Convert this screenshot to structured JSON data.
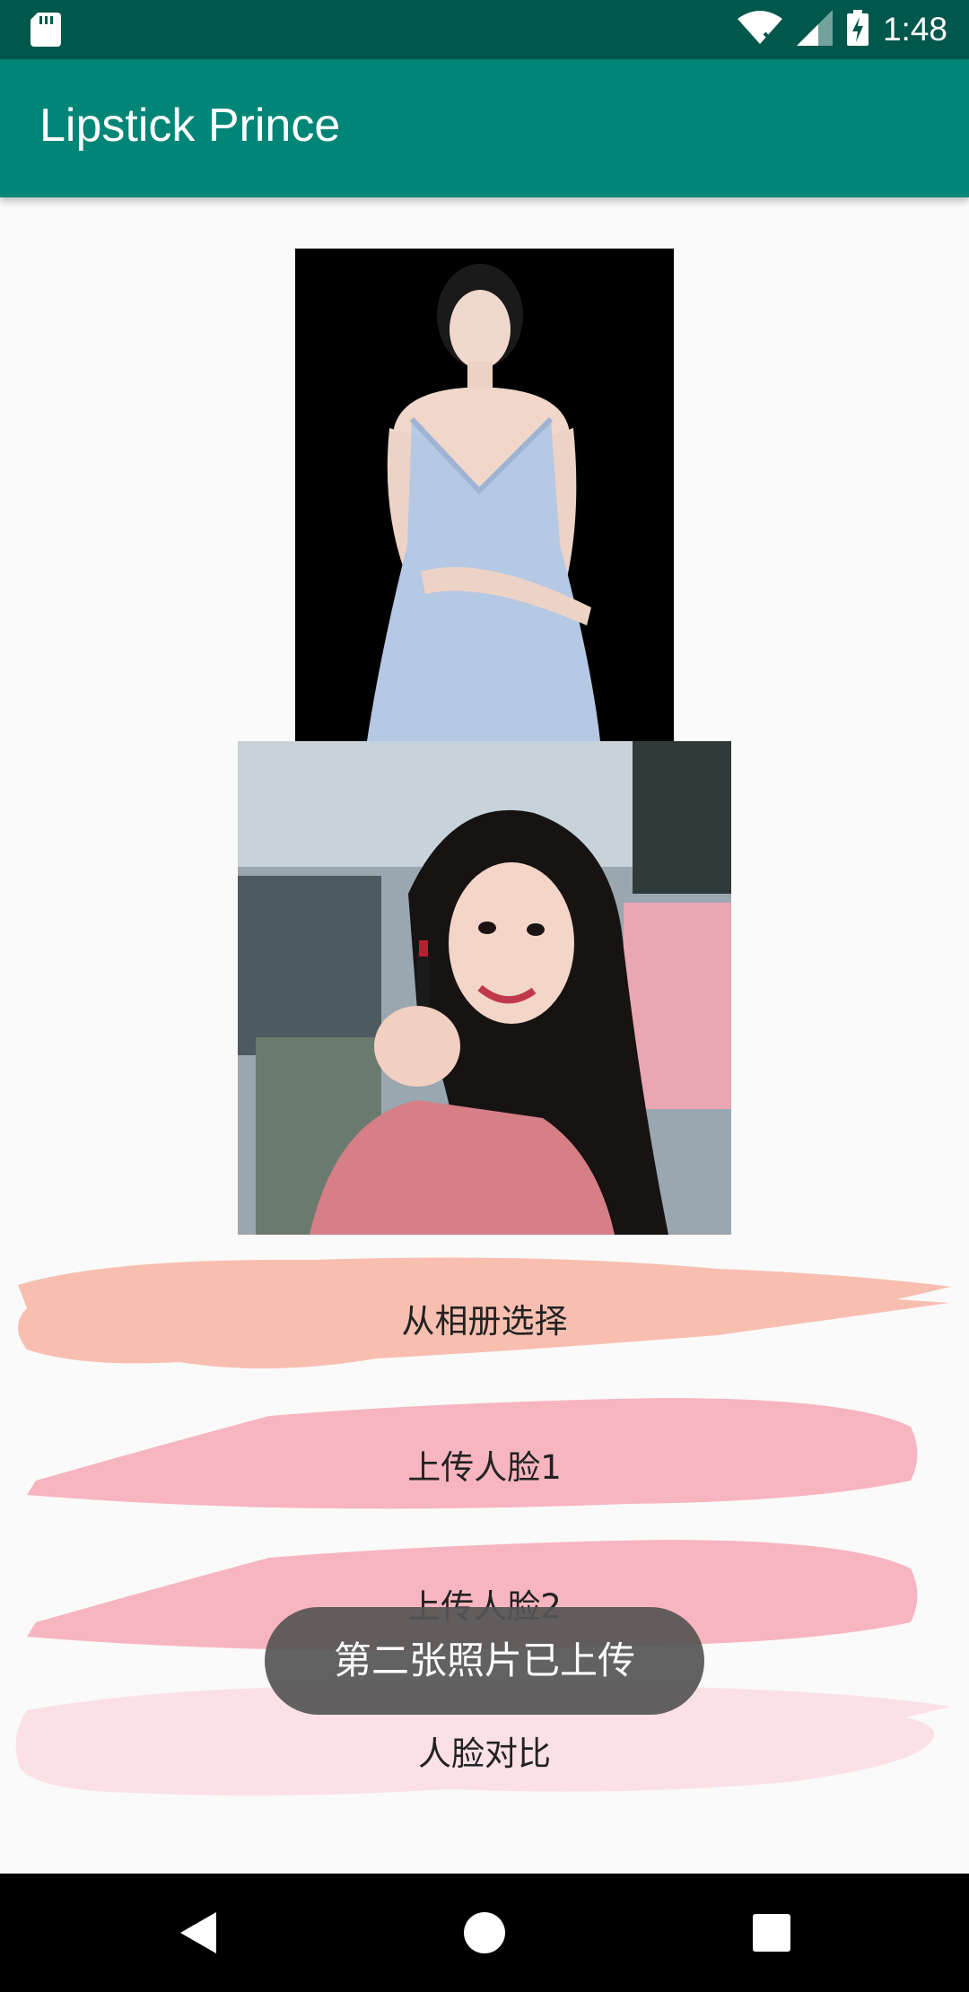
{
  "status_bar": {
    "time": "1:48",
    "icons": [
      "sd-card-icon",
      "wifi-off-icon",
      "signal-icon",
      "battery-charging-icon"
    ]
  },
  "app_bar": {
    "title": "Lipstick Prince"
  },
  "images": [
    {
      "name": "face-photo-1",
      "description_icon": "photo"
    },
    {
      "name": "face-photo-2",
      "description_icon": "photo"
    }
  ],
  "buttons": {
    "select_from_album": "从相册选择",
    "upload_face_1": "上传人脸1",
    "upload_face_2": "上传人脸2",
    "compare_faces": "人脸对比"
  },
  "toast": {
    "message": "第二张照片已上传"
  },
  "colors": {
    "status_bar": "#00574b",
    "app_bar": "#008577",
    "brush_peach": "#f8bfb0",
    "brush_pink": "#f7b5c0",
    "brush_light_pink": "#fbe1e6"
  },
  "nav_bar": {
    "buttons": [
      "back-icon",
      "home-icon",
      "recents-icon"
    ]
  }
}
